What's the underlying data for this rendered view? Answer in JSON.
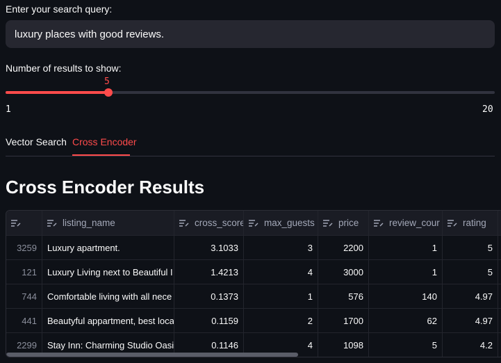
{
  "search": {
    "label": "Enter your search query:",
    "value": "luxury places with good reviews."
  },
  "slider": {
    "label": "Number of results to show:",
    "value": "5",
    "min": "1",
    "max": "20",
    "fraction": 0.2105
  },
  "tabs": [
    {
      "label": "Vector Search",
      "active": false
    },
    {
      "label": "Cross Encoder",
      "active": true
    }
  ],
  "results": {
    "title": "Cross Encoder Results",
    "columns": [
      "listing_name",
      "cross_score",
      "max_guests",
      "price",
      "review_cour",
      "rating"
    ],
    "rows": [
      {
        "index": "3259",
        "listing_name": "Luxury apartment.",
        "cross_score": "3.1033",
        "max_guests": "3",
        "price": "2200",
        "review_count": "1",
        "rating": "5"
      },
      {
        "index": "121",
        "listing_name": "Luxury Living next to Beautiful I",
        "cross_score": "1.4213",
        "max_guests": "4",
        "price": "3000",
        "review_count": "1",
        "rating": "5"
      },
      {
        "index": "744",
        "listing_name": "Comfortable living with all nece",
        "cross_score": "0.1373",
        "max_guests": "1",
        "price": "576",
        "review_count": "140",
        "rating": "4.97"
      },
      {
        "index": "441",
        "listing_name": "Beautyful appartment, best loca",
        "cross_score": "0.1159",
        "max_guests": "2",
        "price": "1700",
        "review_count": "62",
        "rating": "4.97"
      },
      {
        "index": "2299",
        "listing_name": "Stay Inn: Charming Studio Oasis",
        "cross_score": "0.1146",
        "max_guests": "4",
        "price": "1098",
        "review_count": "5",
        "rating": "4.2"
      }
    ]
  },
  "colors": {
    "accent": "#ff4b4b",
    "background": "#0e1117",
    "input_bg": "#262730"
  },
  "icons": {
    "column_header": "text-column-icon"
  }
}
